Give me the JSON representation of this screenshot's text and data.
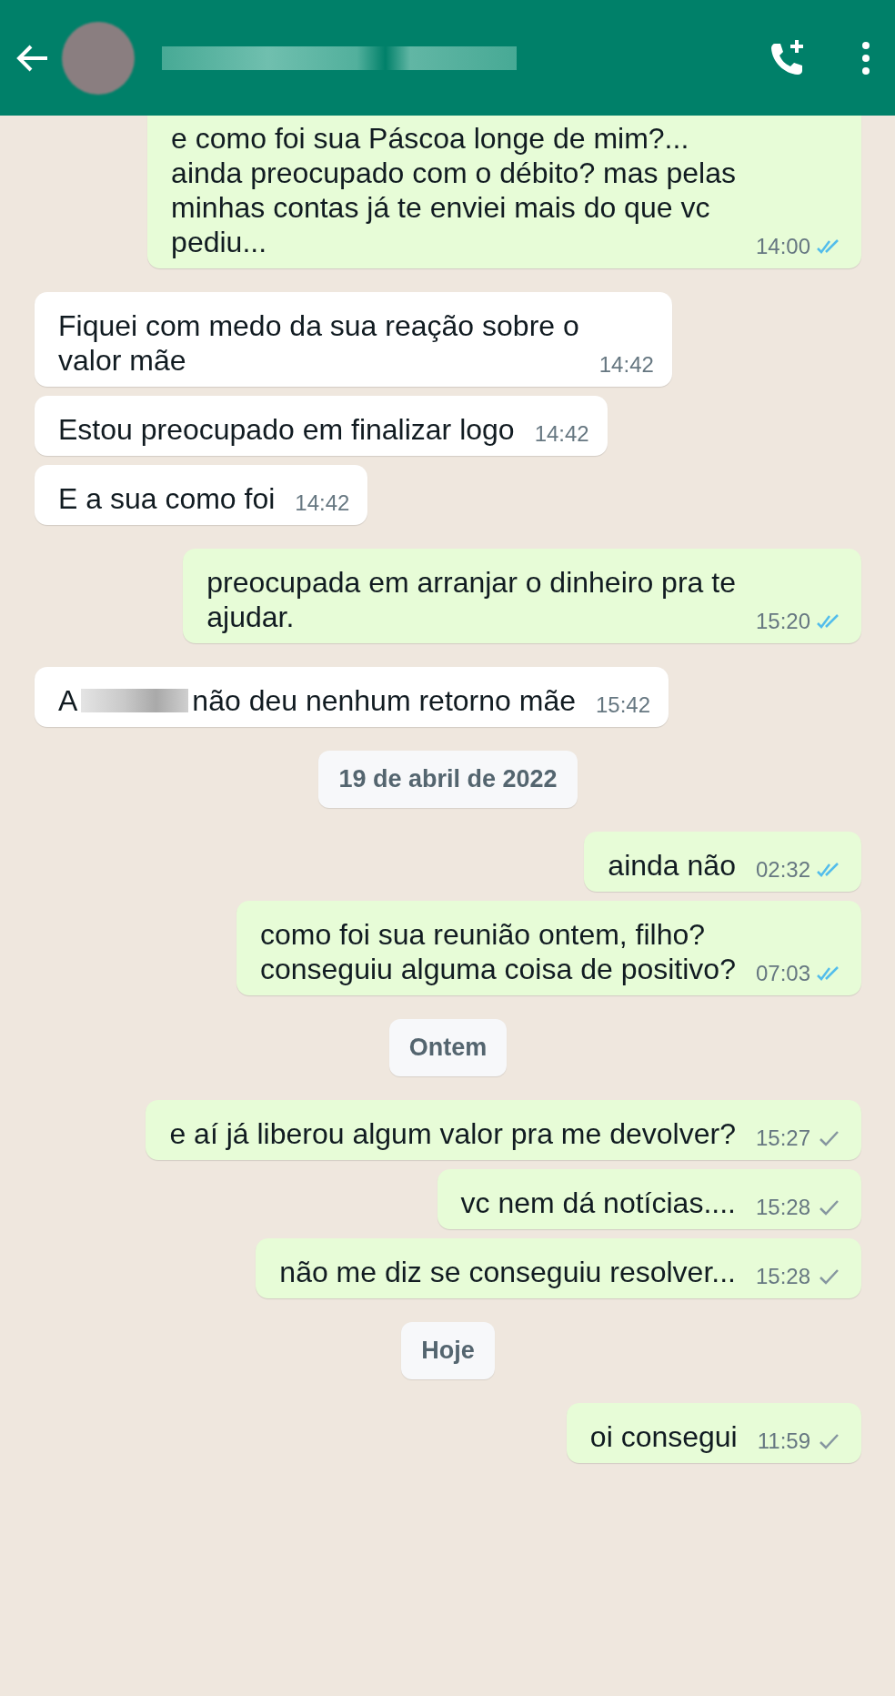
{
  "header": {
    "name_redacted": true
  },
  "messages": [
    {
      "kind": "out",
      "text": "e como foi sua Páscoa longe de mim?...\nainda preocupado com o débito? mas pelas\nminhas contas já te enviei mais do que vc\npediu...",
      "time": "14:00",
      "read": true,
      "cut_top": true
    },
    {
      "kind": "in",
      "text": "Fiquei com medo da sua reação sobre o\nvalor mãe",
      "time": "14:42"
    },
    {
      "kind": "in",
      "text": "Estou preocupado em finalizar logo",
      "time": "14:42"
    },
    {
      "kind": "in",
      "text": "E a sua como foi",
      "time": "14:42"
    },
    {
      "kind": "out",
      "text": "preocupada em arranjar o dinheiro pra te\najudar.",
      "time": "15:20",
      "read": true
    },
    {
      "kind": "in",
      "text": "A",
      "redacted": true,
      "text_after": "não deu nenhum retorno mãe",
      "time": "15:42"
    },
    {
      "kind": "date",
      "text": "19 de abril de 2022"
    },
    {
      "kind": "out",
      "text": "ainda não",
      "time": "02:32",
      "read": true
    },
    {
      "kind": "out",
      "text": "como foi sua reunião ontem, filho?\nconseguiu alguma coisa de positivo?",
      "time": "07:03",
      "read": true
    },
    {
      "kind": "date",
      "text": "Ontem"
    },
    {
      "kind": "out",
      "text": "e aí já liberou algum valor pra me devolver?",
      "time": "15:27",
      "read": false
    },
    {
      "kind": "out",
      "text": "vc nem dá notícias....",
      "time": "15:28",
      "read": false
    },
    {
      "kind": "out",
      "text": "não me diz se conseguiu resolver...",
      "time": "15:28",
      "read": false
    },
    {
      "kind": "date",
      "text": "Hoje"
    },
    {
      "kind": "out",
      "text": "oi consegui",
      "time": "11:59",
      "read": false
    }
  ]
}
